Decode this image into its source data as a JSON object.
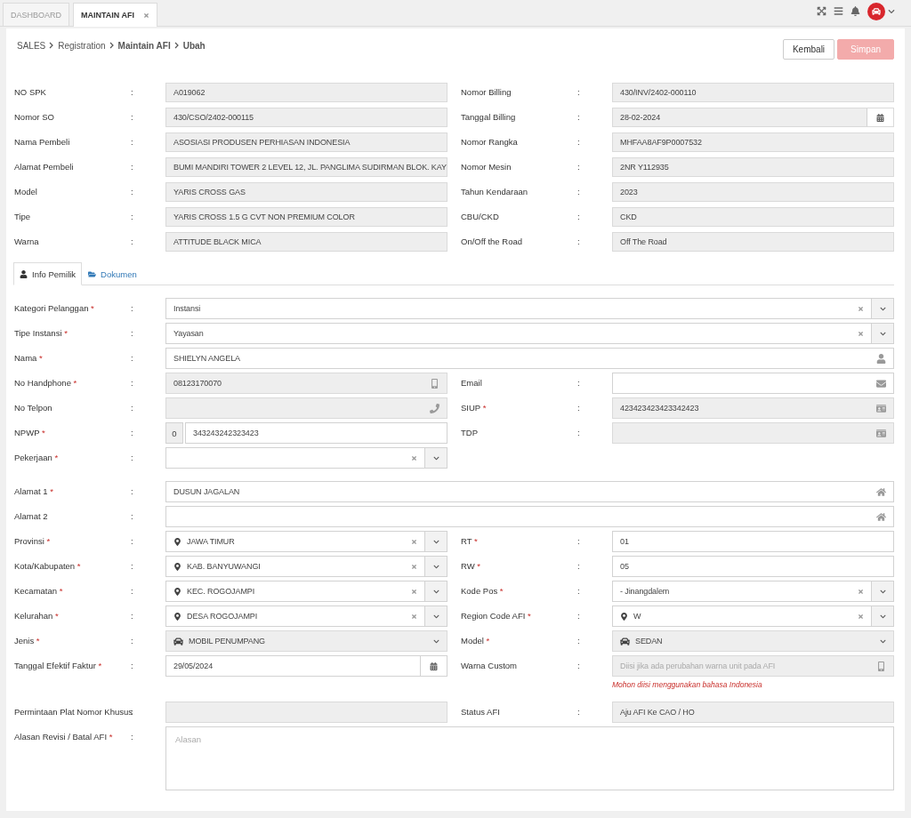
{
  "top_tabs": [
    {
      "label": "DASHBOARD",
      "selected": false,
      "closable": false
    },
    {
      "label": "MAINTAIN AFI",
      "selected": true,
      "closable": true
    }
  ],
  "breadcrumb": [
    {
      "label": "SALES",
      "bold": false
    },
    {
      "label": "Registration",
      "bold": false
    },
    {
      "label": "Maintain AFI",
      "bold": true
    },
    {
      "label": "Ubah",
      "bold": true
    }
  ],
  "actions": [
    {
      "label": "Kembali",
      "kind": "default",
      "disabled": false
    },
    {
      "label": "Simpan",
      "kind": "primary",
      "disabled": true
    }
  ],
  "summary": [
    [
      {
        "label": "NO SPK",
        "sep": ":",
        "kind": "text",
        "readonly": true,
        "value": "A019062"
      },
      {
        "label": "Nomor Billing",
        "sep": ":",
        "kind": "text",
        "readonly": true,
        "value": "430/INV/2402-000110"
      }
    ],
    [
      {
        "label": "Nomor SO",
        "sep": ":",
        "kind": "text",
        "readonly": true,
        "value": "430/CSO/2402-000115"
      },
      {
        "label": "Tanggal Billing",
        "sep": ":",
        "kind": "date",
        "readonly": true,
        "value": "28-02-2024"
      }
    ],
    [
      {
        "label": "Nama Pembeli",
        "sep": ":",
        "kind": "text",
        "readonly": true,
        "value": "ASOSIASI PRODUSEN PERHIASAN INDONESIA"
      },
      {
        "label": "Nomor Rangka",
        "sep": ":",
        "kind": "text",
        "readonly": true,
        "value": "MHFAA8AF9P0007532"
      }
    ],
    [
      {
        "label": "Alamat Pembeli",
        "sep": ":",
        "kind": "text",
        "readonly": true,
        "value": "BUMI MANDIRI TOWER 2 LEVEL 12, JL. PANGLIMA SUDIRMAN BLOK. KAY"
      },
      {
        "label": "Nomor Mesin",
        "sep": ":",
        "kind": "text",
        "readonly": true,
        "value": "2NR Y112935"
      }
    ],
    [
      {
        "label": "Model",
        "sep": ":",
        "kind": "text",
        "readonly": true,
        "value": "YARIS CROSS GAS"
      },
      {
        "label": "Tahun Kendaraan",
        "sep": ":",
        "kind": "text",
        "readonly": true,
        "value": "2023"
      }
    ],
    [
      {
        "label": "Tipe",
        "sep": ":",
        "kind": "text",
        "readonly": true,
        "value": "YARIS CROSS 1.5 G CVT NON PREMIUM COLOR"
      },
      {
        "label": "CBU/CKD",
        "sep": ":",
        "kind": "text",
        "readonly": true,
        "value": "CKD"
      }
    ],
    [
      {
        "label": "Warna",
        "sep": ":",
        "kind": "text",
        "readonly": true,
        "value": "ATTITUDE BLACK MICA"
      },
      {
        "label": "On/Off the Road",
        "sep": ":",
        "kind": "text",
        "readonly": true,
        "value": "Off The Road"
      }
    ]
  ],
  "tabs": [
    {
      "label": "Info Pemilik",
      "kind": "person",
      "selected": true
    },
    {
      "label": "Dokumen",
      "kind": "folder",
      "selected": false
    }
  ],
  "form_sections": [
    [
      [
        {
          "label": "Kategori Pelanggan",
          "mark": "*",
          "sep": ":",
          "kind": "select",
          "readonly": false,
          "clearable": true,
          "value": "Instansi"
        }
      ],
      [
        {
          "label": "Tipe Instansi",
          "mark": "*",
          "sep": ":",
          "kind": "select",
          "readonly": false,
          "clearable": true,
          "value": "Yayasan"
        }
      ],
      [
        {
          "label": "Nama",
          "mark": "*",
          "sep": ":",
          "kind": "person",
          "readonly": false,
          "value": "SHIELYN ANGELA"
        }
      ],
      [
        {
          "label": "No Handphone",
          "mark": "*",
          "sep": ":",
          "kind": "mobile",
          "readonly": true,
          "value": "08123170070"
        },
        {
          "label": "Email",
          "sep": ":",
          "kind": "email",
          "readonly": false
        }
      ],
      [
        {
          "label": "No Telpon",
          "sep": ":",
          "kind": "phone",
          "readonly": true
        },
        {
          "label": "SIUP",
          "mark": "*",
          "sep": ":",
          "kind": "id-card",
          "readonly": true,
          "value": "423423423423342423"
        }
      ],
      [
        {
          "label": "NPWP",
          "mark": "*",
          "sep": ":",
          "kind": "prefixed",
          "readonly": false,
          "prefix": "0",
          "value": "343243242323423"
        },
        {
          "label": "TDP",
          "sep": ":",
          "kind": "id-card",
          "readonly": true
        }
      ],
      [
        {
          "label": "Pekerjaan",
          "mark": "*",
          "sep": ":",
          "kind": "select",
          "readonly": false,
          "clearable": true
        }
      ]
    ],
    [
      [
        {
          "label": "Alamat 1",
          "mark": "*",
          "sep": ":",
          "kind": "address",
          "readonly": false,
          "value": "DUSUN JAGALAN"
        }
      ],
      [
        {
          "label": "Alamat 2",
          "sep": ":",
          "kind": "address",
          "readonly": false
        }
      ],
      [
        {
          "label": "Provinsi",
          "mark": "*",
          "sep": ":",
          "kind": "place-select",
          "readonly": false,
          "clearable": true,
          "value": "JAWA TIMUR"
        },
        {
          "label": "RT",
          "mark": "*",
          "sep": ":",
          "kind": "text",
          "readonly": false,
          "value": "01"
        }
      ],
      [
        {
          "label": "Kota/Kabupaten",
          "mark": "*",
          "sep": ":",
          "kind": "place-select",
          "readonly": false,
          "clearable": true,
          "value": "KAB. BANYUWANGI"
        },
        {
          "label": "RW",
          "mark": "*",
          "sep": ":",
          "kind": "text",
          "readonly": false,
          "value": "05"
        }
      ],
      [
        {
          "label": "Kecamatan",
          "mark": "*",
          "sep": ":",
          "kind": "place-select",
          "readonly": false,
          "clearable": true,
          "value": "KEC. ROGOJAMPI"
        },
        {
          "label": "Kode Pos",
          "mark": "*",
          "sep": ":",
          "kind": "select",
          "readonly": false,
          "clearable": true,
          "value": "- Jinangdalem"
        }
      ],
      [
        {
          "label": "Kelurahan",
          "mark": "*",
          "sep": ":",
          "kind": "place-select",
          "readonly": false,
          "clearable": true,
          "value": "DESA ROGOJAMPI"
        },
        {
          "label": "Region Code AFI",
          "mark": "*",
          "sep": ":",
          "kind": "place-select",
          "readonly": false,
          "clearable": true,
          "value": "W"
        }
      ],
      [
        {
          "label": "Jenis",
          "mark": "*",
          "sep": ":",
          "kind": "vehicle-select",
          "readonly": true,
          "clearable": false,
          "value": "MOBIL PENUMPANG"
        },
        {
          "label": "Model",
          "mark": "*",
          "sep": ":",
          "kind": "vehicle-select",
          "readonly": true,
          "clearable": false,
          "value": "SEDAN"
        }
      ],
      [
        {
          "label": "Tanggal Efektif Faktur",
          "mark": "*",
          "sep": ":",
          "kind": "date",
          "readonly": false,
          "value": "29/05/2024"
        },
        {
          "label": "Warna Custom",
          "sep": ":",
          "kind": "mobile",
          "readonly": true,
          "placeholder": "Diisi jika ada perubahan warna unit pada AFI",
          "note": "Mohon diisi menggunakan bahasa Indonesia"
        }
      ]
    ],
    [
      [
        {
          "label": "Permintaan Plat Nomor Khusus",
          "sep": ":",
          "kind": "text",
          "readonly": true
        },
        {
          "label": "Status AFI",
          "sep": ":",
          "kind": "text",
          "readonly": true,
          "value": "Aju AFI Ke CAO / HO"
        }
      ],
      [
        {
          "label": "Alasan Revisi / Batal AFI",
          "mark": "*",
          "sep": ":",
          "kind": "textarea",
          "readonly": false,
          "placeholder": "Alasan"
        }
      ]
    ]
  ]
}
